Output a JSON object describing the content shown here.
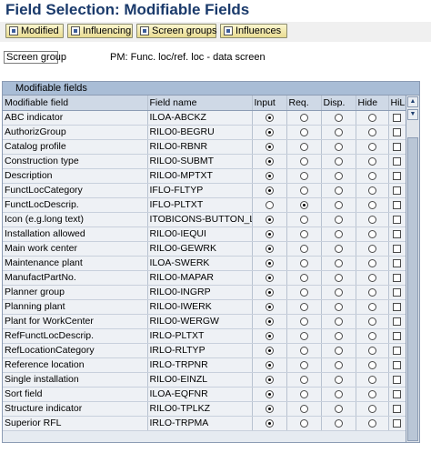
{
  "title": "Field Selection: Modifiable Fields",
  "toolbar": {
    "buttons": [
      "Modified",
      "Influencing",
      "Screen groups",
      "Influences"
    ]
  },
  "screen_group": {
    "label": "Screen group",
    "value": "PM: Func. loc/ref. loc - data screen"
  },
  "grid": {
    "title": "Modifiable fields",
    "columns": [
      "Modifiable field",
      "Field name",
      "Input",
      "Req.",
      "Disp.",
      "Hide",
      "HiLi"
    ],
    "rows": [
      {
        "label": "ABC indicator",
        "field": "ILOA-ABCKZ",
        "sel": "input"
      },
      {
        "label": "AuthorizGroup",
        "field": "RILO0-BEGRU",
        "sel": "input"
      },
      {
        "label": "Catalog profile",
        "field": "RILO0-RBNR",
        "sel": "input"
      },
      {
        "label": "Construction type",
        "field": "RILO0-SUBMT",
        "sel": "input"
      },
      {
        "label": "Description",
        "field": "RILO0-MPTXT",
        "sel": "input"
      },
      {
        "label": "FunctLocCategory",
        "field": "IFLO-FLTYP",
        "sel": "input"
      },
      {
        "label": "FunctLocDescrip.",
        "field": "IFLO-PLTXT",
        "sel": "req"
      },
      {
        "label": "Icon (e.g.long text)",
        "field": "ITOBICONS-BUTTON_LGT",
        "sel": "input"
      },
      {
        "label": "Installation allowed",
        "field": "RILO0-IEQUI",
        "sel": "input"
      },
      {
        "label": "Main work center",
        "field": "RILO0-GEWRK",
        "sel": "input"
      },
      {
        "label": "Maintenance plant",
        "field": "ILOA-SWERK",
        "sel": "input"
      },
      {
        "label": "ManufactPartNo.",
        "field": "RILO0-MAPAR",
        "sel": "input"
      },
      {
        "label": "Planner group",
        "field": "RILO0-INGRP",
        "sel": "input"
      },
      {
        "label": "Planning plant",
        "field": "RILO0-IWERK",
        "sel": "input"
      },
      {
        "label": "Plant for WorkCenter",
        "field": "RILO0-WERGW",
        "sel": "input"
      },
      {
        "label": "RefFunctLocDescrip.",
        "field": "IRLO-PLTXT",
        "sel": "input"
      },
      {
        "label": "RefLocationCategory",
        "field": "IRLO-RLTYP",
        "sel": "input"
      },
      {
        "label": "Reference location",
        "field": "IRLO-TRPNR",
        "sel": "input"
      },
      {
        "label": "Single installation",
        "field": "RILO0-EINZL",
        "sel": "input"
      },
      {
        "label": "Sort field",
        "field": "ILOA-EQFNR",
        "sel": "input"
      },
      {
        "label": "Structure indicator",
        "field": "RILO0-TPLKZ",
        "sel": "input"
      },
      {
        "label": "Superior RFL",
        "field": "IRLO-TRPMA",
        "sel": "input"
      }
    ]
  },
  "scrollbar": {
    "up_arrow": "▲",
    "down_arrow": "▼"
  }
}
